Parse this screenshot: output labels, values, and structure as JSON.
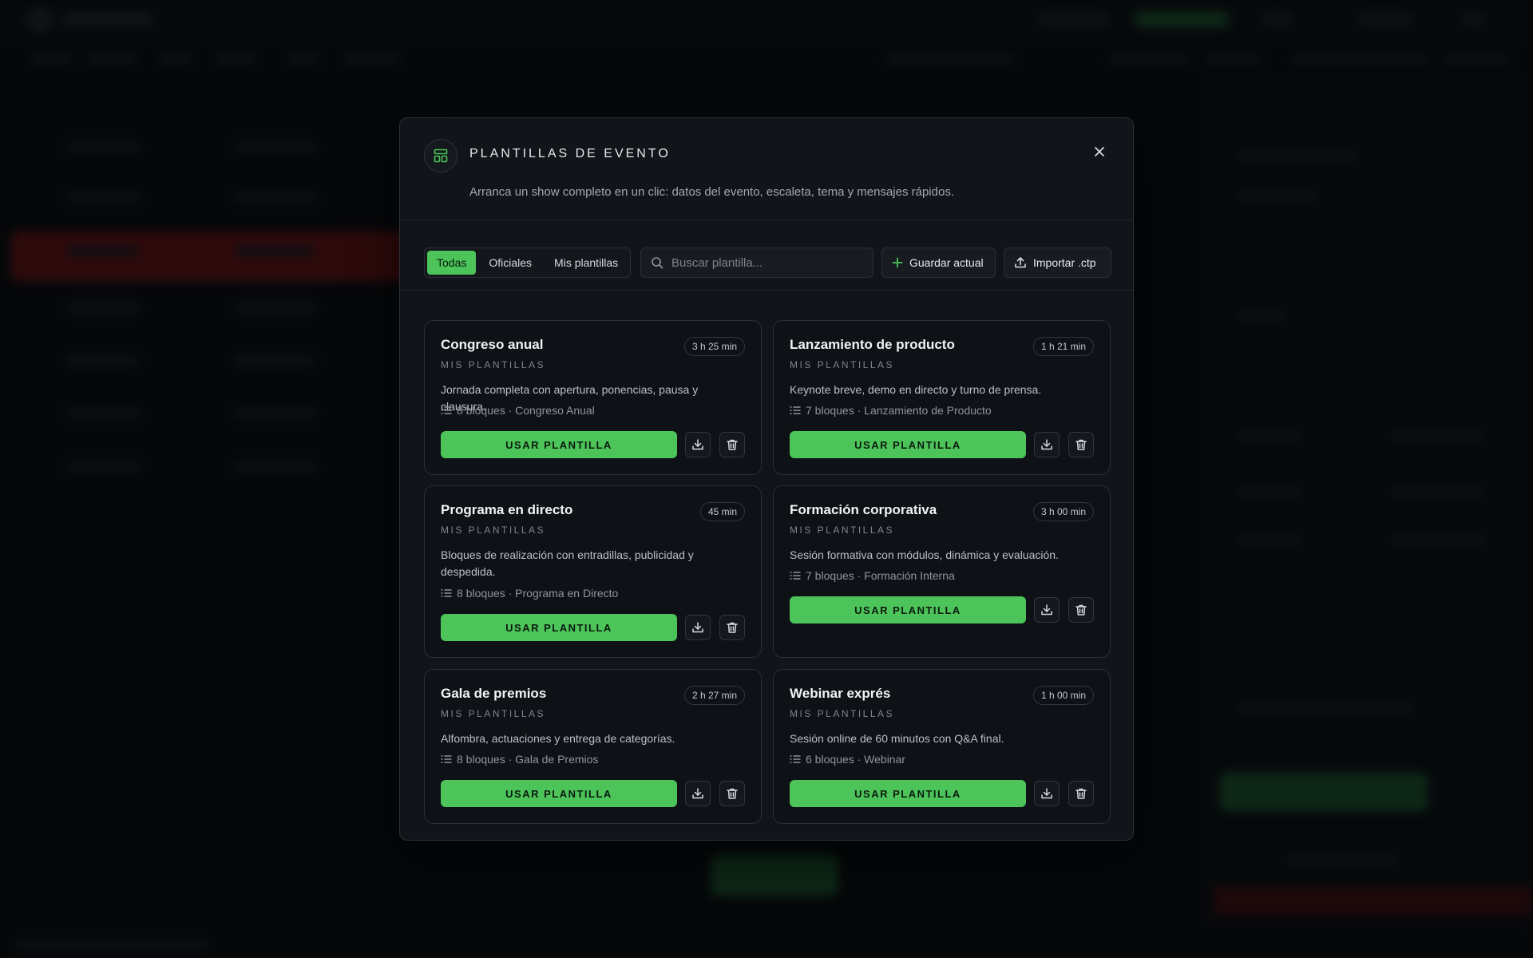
{
  "modal": {
    "title": "PLANTILLAS DE EVENTO",
    "subtitle": "Arranca un show completo en un clic: datos del evento, escaleta, tema y mensajes rápidos."
  },
  "toolbar": {
    "filters": [
      "Todas",
      "Oficiales",
      "Mis plantillas"
    ],
    "active_filter": "Todas",
    "search_placeholder": "Buscar plantilla...",
    "save_label": "Guardar actual",
    "import_label": "Importar .ctp"
  },
  "use_label": "USAR PLANTILLA",
  "templates": [
    {
      "title": "Congreso anual",
      "duration": "3 h 25 min",
      "category": "MIS PLANTILLAS",
      "description": "Jornada completa con apertura, ponencias, pausa y clausura.",
      "meta": "8 bloques · Congreso Anual"
    },
    {
      "title": "Lanzamiento de producto",
      "duration": "1 h 21 min",
      "category": "MIS PLANTILLAS",
      "description": "Keynote breve, demo en directo y turno de prensa.",
      "meta": "7 bloques · Lanzamiento de Producto"
    },
    {
      "title": "Programa en directo",
      "duration": "45 min",
      "category": "MIS PLANTILLAS",
      "description": "Bloques de realización con entradillas, publicidad y despedida.",
      "meta": "8 bloques · Programa en Directo"
    },
    {
      "title": "Formación corporativa",
      "duration": "3 h 00 min",
      "category": "MIS PLANTILLAS",
      "description": "Sesión formativa con módulos, dinámica y evaluación.",
      "meta": "7 bloques · Formación Interna"
    },
    {
      "title": "Gala de premios",
      "duration": "2 h 27 min",
      "category": "MIS PLANTILLAS",
      "description": "Alfombra, actuaciones y entrega de categorías.",
      "meta": "8 bloques · Gala de Premios"
    },
    {
      "title": "Webinar exprés",
      "duration": "1 h 00 min",
      "category": "MIS PLANTILLAS",
      "description": "Sesión online de 60 minutos con Q&A final.",
      "meta": "6 bloques · Webinar"
    }
  ],
  "colors": {
    "accent": "#4cc45a",
    "panel": "#111418",
    "card": "#0e1115",
    "border": "#2a3037"
  },
  "icons": {
    "header": "template-layout-icon",
    "close": "close-icon",
    "add": "plus-icon",
    "import": "upload-icon",
    "search": "search-icon",
    "list": "list-icon",
    "download": "download-icon",
    "delete": "trash-icon"
  }
}
